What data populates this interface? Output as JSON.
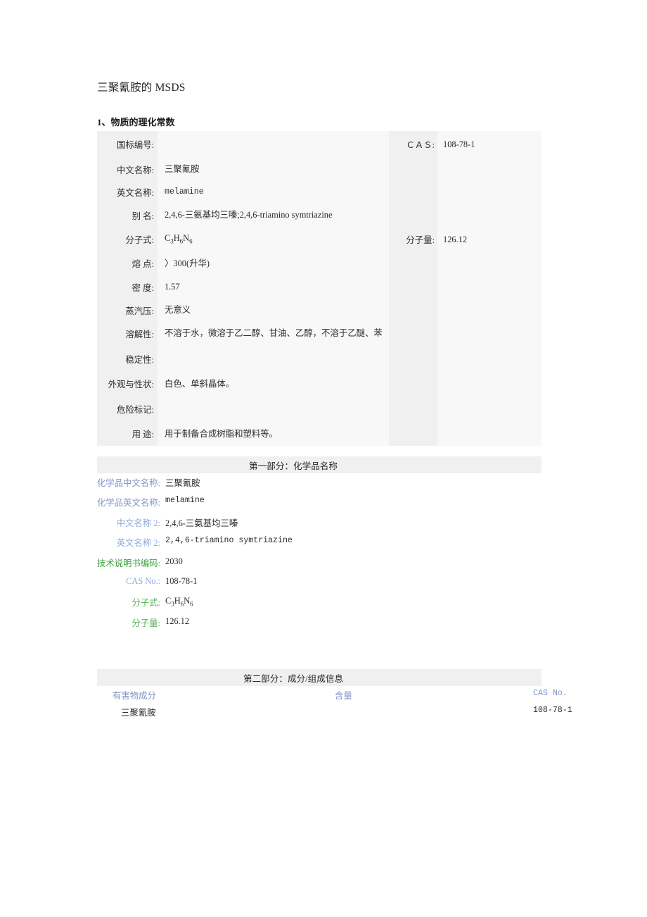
{
  "document": {
    "title": "三聚氰胺的 MSDS",
    "section_heading": "1、物质的理化常数"
  },
  "properties_table": {
    "rows": [
      {
        "label": "国标编号:",
        "value": "",
        "label2": "ＣＡＳ:",
        "value2": "108-78-1"
      },
      {
        "label": "中文名称:",
        "value": "三聚氰胺",
        "label2": "",
        "value2": ""
      },
      {
        "label": "英文名称:",
        "value": "melamine",
        "label2": "",
        "value2": ""
      },
      {
        "label": "别 名:",
        "value": "2,4,6-三氨基均三嗪;2,4,6-triamino symtriazine",
        "label2": "",
        "value2": ""
      },
      {
        "label": "分子式:",
        "value": "C3H6N6",
        "label2": "分子量:",
        "value2": "126.12"
      },
      {
        "label": "熔 点:",
        "value": "〉300(升华)",
        "label2": "",
        "value2": ""
      },
      {
        "label": "密 度:",
        "value": "1.57",
        "label2": "",
        "value2": ""
      },
      {
        "label": "蒸汽压:",
        "value": "无意义",
        "label2": "",
        "value2": ""
      },
      {
        "label": "溶解性:",
        "value": "不溶于水，微溶于乙二醇、甘油、乙醇，不溶于乙醚、苯",
        "label2": "",
        "value2": ""
      },
      {
        "label": "稳定性:",
        "value": "",
        "label2": "",
        "value2": ""
      },
      {
        "label": "外观与性状:",
        "value": "白色、单斜晶体。",
        "label2": "",
        "value2": ""
      },
      {
        "label": "危险标记:",
        "value": "",
        "label2": "",
        "value2": ""
      },
      {
        "label": "用 途:",
        "value": "用于制备合成树脂和塑料等。",
        "label2": "",
        "value2": ""
      }
    ]
  },
  "part_one": {
    "bar_title": "第一部分：化学品名称",
    "rows": [
      {
        "label": "化学品中文名称:",
        "value": "三聚氰胺",
        "color": "c-blue-dark",
        "mono": false
      },
      {
        "label": "化学品英文名称:",
        "value": "melamine",
        "color": "c-blue-dark",
        "mono": true
      },
      {
        "label": "中文名称 2:",
        "value": "2,4,6-三氨基均三嗪",
        "color": "c-blue-light",
        "mono": false
      },
      {
        "label": "英文名称 2:",
        "value": "2,4,6-triamino symtriazine",
        "color": "c-blue-light",
        "mono": true
      },
      {
        "label": "技术说明书编码:",
        "value": "2030",
        "color": "c-green",
        "mono": false
      },
      {
        "label": "CAS No.:",
        "value": "108-78-1",
        "color": "c-blue-light",
        "mono": false
      },
      {
        "label": "分子式:",
        "value": "C3H6N6",
        "color": "c-green-lt",
        "mono": false
      },
      {
        "label": "分子量:",
        "value": "126.12",
        "color": "c-green-lt",
        "mono": false
      }
    ]
  },
  "part_two": {
    "bar_title": "第二部分：成分/组成信息",
    "headers": [
      "有害物成分",
      "含量",
      "CAS No."
    ],
    "rows": [
      {
        "component": "三聚氰胺",
        "content": "",
        "cas": "108-78-1"
      }
    ]
  }
}
